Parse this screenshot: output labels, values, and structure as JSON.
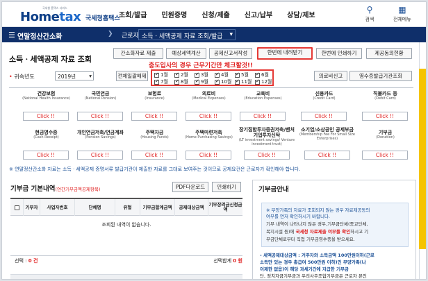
{
  "header": {
    "logo_tiny": "국세청 홈택스 서비스",
    "logo_home": "Home",
    "logo_tax": "tax",
    "logo_org": "국세청홈택스",
    "nav": [
      "조회/발급",
      "민원증명",
      "신청/제출",
      "신고/납부",
      "상담/제보"
    ],
    "search_label": "검색",
    "menu_label": "전체메뉴"
  },
  "subbar": {
    "section": "연말정산간소화",
    "crumb1": "근로자",
    "crumb2": "소득ㆍ세액공제 자료 조회/발급"
  },
  "page": {
    "title": "소득ㆍ세액공제 자료 조회",
    "buttons": {
      "docs": "간소화자료 제출",
      "predict": "예상세액계산",
      "writing": "공제신고서작성",
      "download": "한번에 내려받기",
      "print": "한번에 인쇄하기",
      "agree": "제공동의현황",
      "select_all": "전체일괄해제",
      "medical": "의료비신고",
      "receipt": "영수증발급기관조회"
    },
    "notice_red": "중도입사의 경우 근무기간만 체크할것!!",
    "year_label": "귀속년도",
    "year_value": "2019년",
    "months": [
      "1월",
      "2월",
      "3월",
      "4월",
      "5월",
      "6월",
      "7월",
      "8월",
      "9월",
      "10월",
      "11월",
      "12월"
    ],
    "warn": "※ 연말정산간소화 자료는 소득ㆍ세액공제 증명서류 발급기관이 제출한 자료를 그대로 보여주는 것이므로 공제요건은 근로자가 확인해야 합니다."
  },
  "categories": [
    {
      "name": "건강보험",
      "sub": "(National Health Insurance)",
      "click": "Click !!"
    },
    {
      "name": "국민연금",
      "sub": "(National Pension)",
      "click": "Click !!"
    },
    {
      "name": "보험료",
      "sub": "(Insurance)",
      "click": "Click !!"
    },
    {
      "name": "의료비",
      "sub": "(Medical Expenses)",
      "click": "Click !!"
    },
    {
      "name": "교육비",
      "sub": "(Education Expenses)",
      "click": "Click !!"
    },
    {
      "name": "신용카드",
      "sub": "(Credit Card)",
      "click": "Click !!"
    },
    {
      "name": "직불카드 등",
      "sub": "(Debit Card)",
      "click": "Click !!"
    },
    {
      "name": "현금영수증",
      "sub": "(Cash Receipt)",
      "click": "Click !!"
    },
    {
      "name": "개인연금저축/연금계좌",
      "sub": "(Pension Savings)",
      "click": "Click !!"
    },
    {
      "name": "주택자금",
      "sub": "(Housing Funds)",
      "click": "Click !!"
    },
    {
      "name": "주택마련저축",
      "sub": "(Home Purchasing Savings)",
      "click": "Click !!"
    },
    {
      "name": "장기집합투자증권저축/벤처기업투자신탁",
      "sub": "(LT investment savings/ Venture investment trust)",
      "click": "Click !!"
    },
    {
      "name": "소기업/소상공인 공제부금",
      "sub": "(Membership Fee For Small Size Enterprises)",
      "click": "Click !!"
    },
    {
      "name": "기부금",
      "sub": "(Donation)",
      "click": "Click !!"
    }
  ],
  "donation": {
    "title": "기부금 기본내역",
    "title_note": "(연간기부금액공제항목)",
    "pdf_btn": "PDF다운로드",
    "print_btn": "인쇄하기",
    "columns": [
      "기부자",
      "사업자번호",
      "단체명",
      "유형",
      "기부금합계금액",
      "공제대상금액",
      "기부장려금신청금액"
    ],
    "empty": "조회된 내역이 없습니다.",
    "sel_label": "선택 :",
    "sel_count": "0 건",
    "total_label": "선택합계",
    "total_value": "0 원"
  },
  "guide": {
    "title": "기부금안내",
    "lines": [
      "※ 부양가족의 자료가 조회되지 않는 경우 자료제공동의",
      "여부를 먼저 확인하시기 바랍니다.",
      "기부 내역이 나타나지 않은 경우,기부금단체(종교단체,",
      "복지시설 등)에",
      "국세청 자료제출 여부를 확인",
      "하시고 기",
      "부금단체로부터 직접 기부금영수증을 받으세요."
    ],
    "note1": "- 세액공제대상금액 : 거주자와 소득금액 100만원이하(근로",
    "note2": "소득만 있는 경우 총급여 500만원 이하)인 부양가족(나",
    "note3": "이제한 없음)이 해당 과세기간에 지급한 기부금",
    "note4": "단, 정치자금기부금과 우리사주조합기부금은 근로자 본인"
  },
  "colors": {
    "navy": "#0f2f6a",
    "red": "#e53935",
    "blue": "#1a4f96"
  }
}
